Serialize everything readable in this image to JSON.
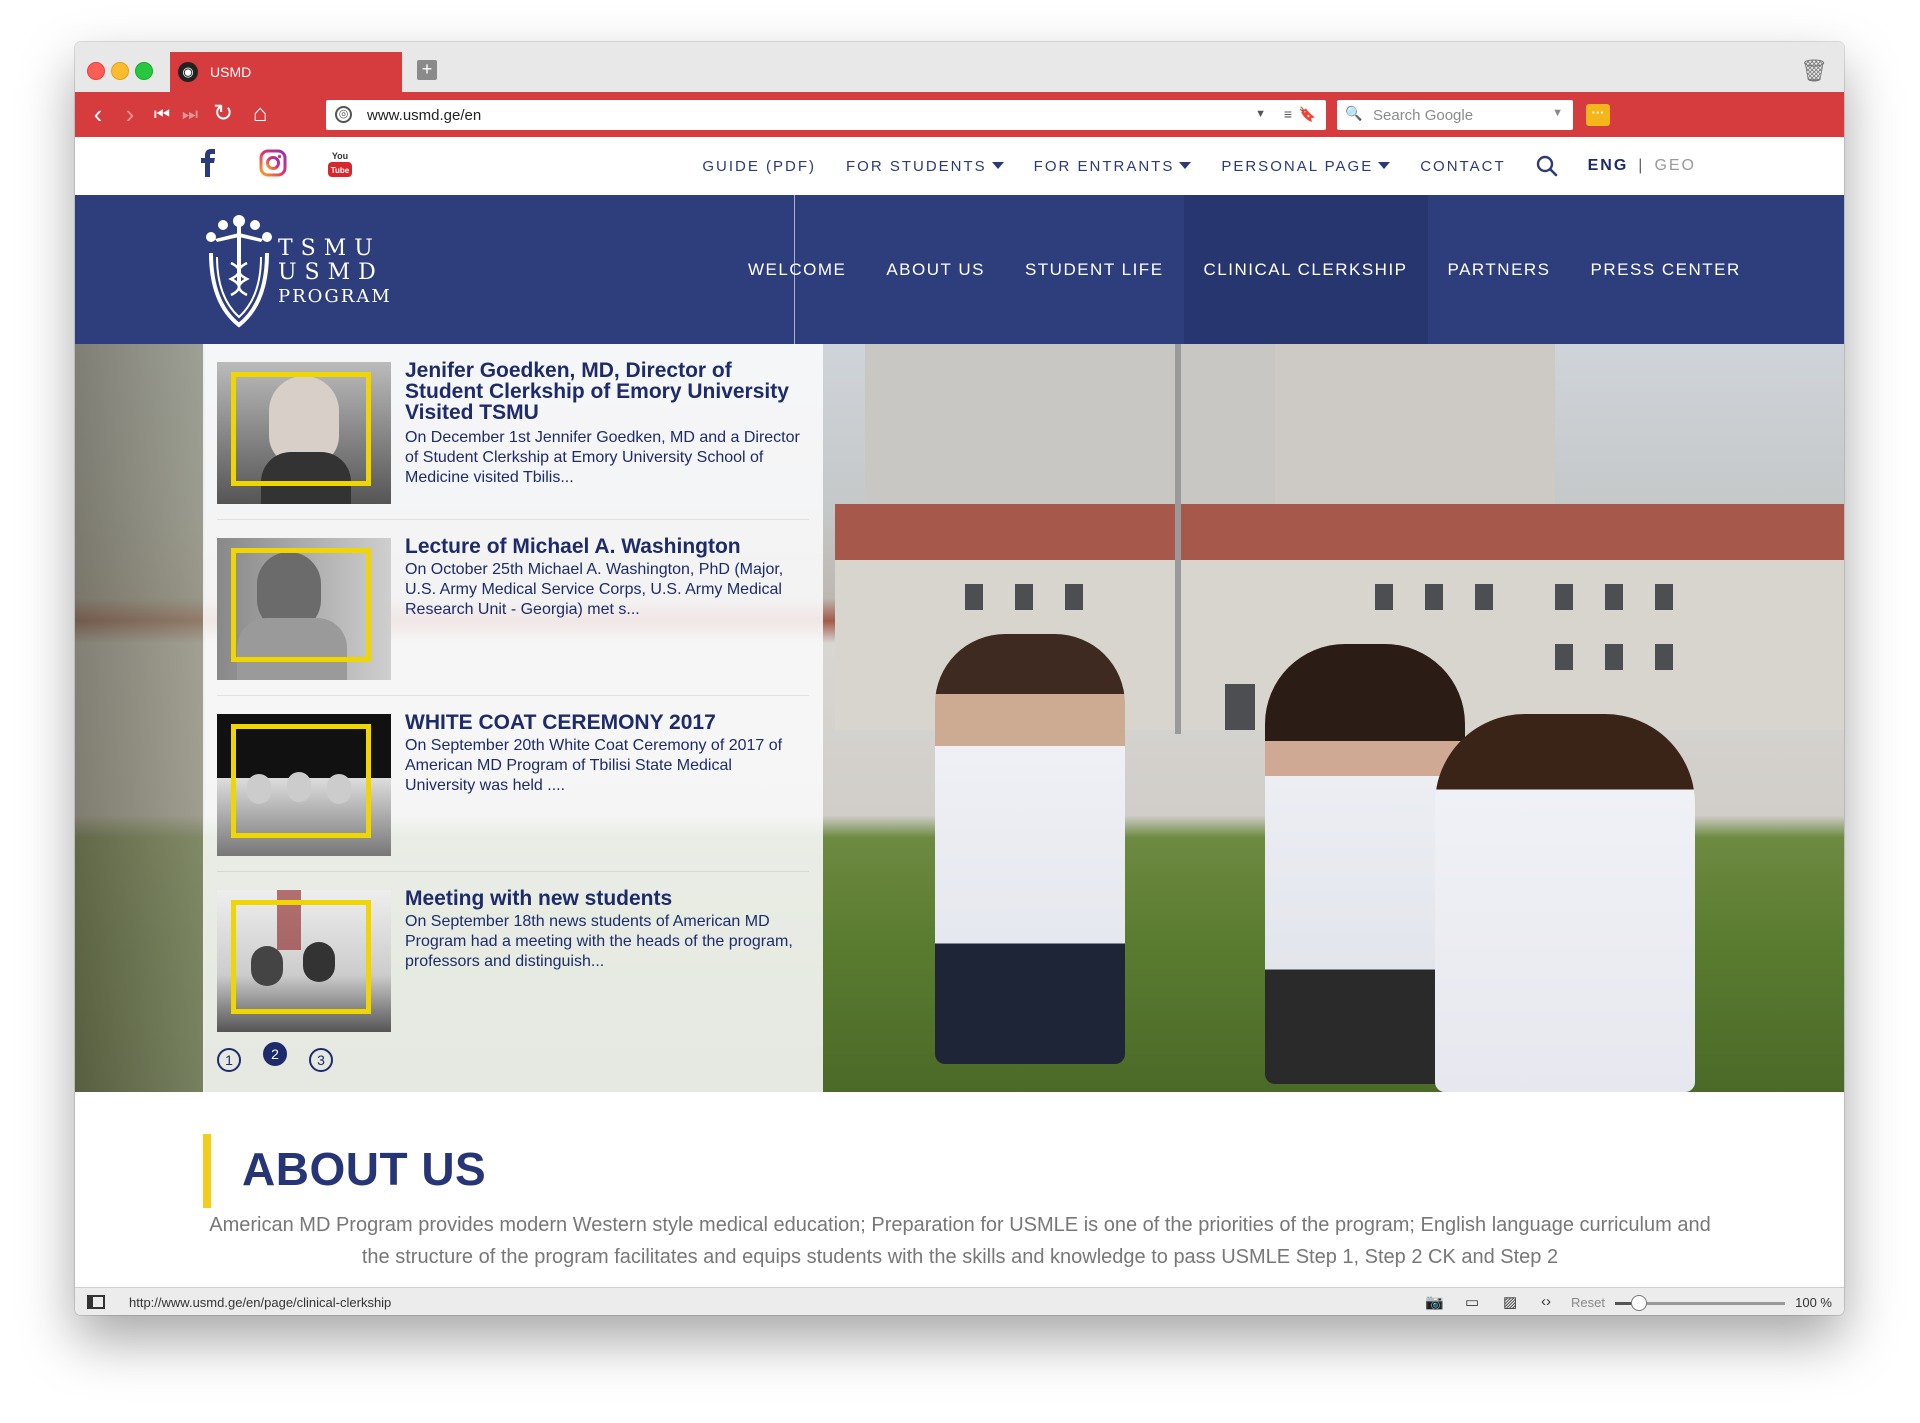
{
  "browser": {
    "tab_title": "USMD",
    "url": "www.usmd.ge/en",
    "search_placeholder": "Search Google",
    "status_url": "http://www.usmd.ge/en/page/clinical-clerkship",
    "reset_label": "Reset",
    "zoom": "100 %",
    "zoom_fraction": 0.14,
    "accent_color": "#d63b3e"
  },
  "site": {
    "social": [
      "facebook-icon",
      "instagram-icon",
      "youtube-icon"
    ],
    "topnav": [
      {
        "label": "GUIDE (PDF)",
        "dropdown": false
      },
      {
        "label": "FOR STUDENTS",
        "dropdown": true
      },
      {
        "label": "FOR ENTRANTS",
        "dropdown": true
      },
      {
        "label": "PERSONAL PAGE",
        "dropdown": true
      },
      {
        "label": "CONTACT",
        "dropdown": false
      }
    ],
    "lang_active": "ENG",
    "lang_sep": "|",
    "lang_inactive": "GEO",
    "logo": {
      "line1": "TSMU",
      "line2": "USMD",
      "line3": "PROGRAM"
    },
    "mainnav": [
      {
        "label": "WELCOME"
      },
      {
        "label": "ABOUT US"
      },
      {
        "label": "STUDENT LIFE"
      },
      {
        "label": "CLINICAL CLERKSHIP",
        "active": true
      },
      {
        "label": "PARTNERS"
      },
      {
        "label": "PRESS CENTER"
      }
    ],
    "brand_color": "#2e3d7b",
    "highlight_color": "#f0d600"
  },
  "news": [
    {
      "title": "Jenifer Goedken, MD, Director of Student Clerkship of Emory University Visited TSMU",
      "excerpt": "On  December 1st Jennifer Goedken, MD and a Director of Student Clerkship at Emory University School of Medicine visited Tbilis..."
    },
    {
      "title": "Lecture of Michael A. Washington",
      "excerpt": "On October 25th Michael A. Washington, PhD (Major, U.S. Army Medical Service Corps, U.S. Army Medical Research Unit - Georgia) met s..."
    },
    {
      "title": "WHITE COAT CEREMONY 2017",
      "excerpt": "On September 20th White Coat Ceremony of 2017 of  American MD Program of Tbilisi State Medical University was held ...."
    },
    {
      "title": "Meeting with new students",
      "excerpt": "On September 18th  news students of American MD Program had a meeting with the heads of the program, professors and distinguish..."
    }
  ],
  "pager": {
    "pages": [
      "1",
      "2",
      "3"
    ],
    "active": "2"
  },
  "about": {
    "title": "ABOUT US",
    "text": "American MD Program provides modern Western style medical education; Preparation for USMLE is one of the priorities of the program; English language curriculum and the structure of the program facilitates and equips students with the skills and knowledge to pass USMLE Step 1, Step 2 CK and Step 2"
  }
}
